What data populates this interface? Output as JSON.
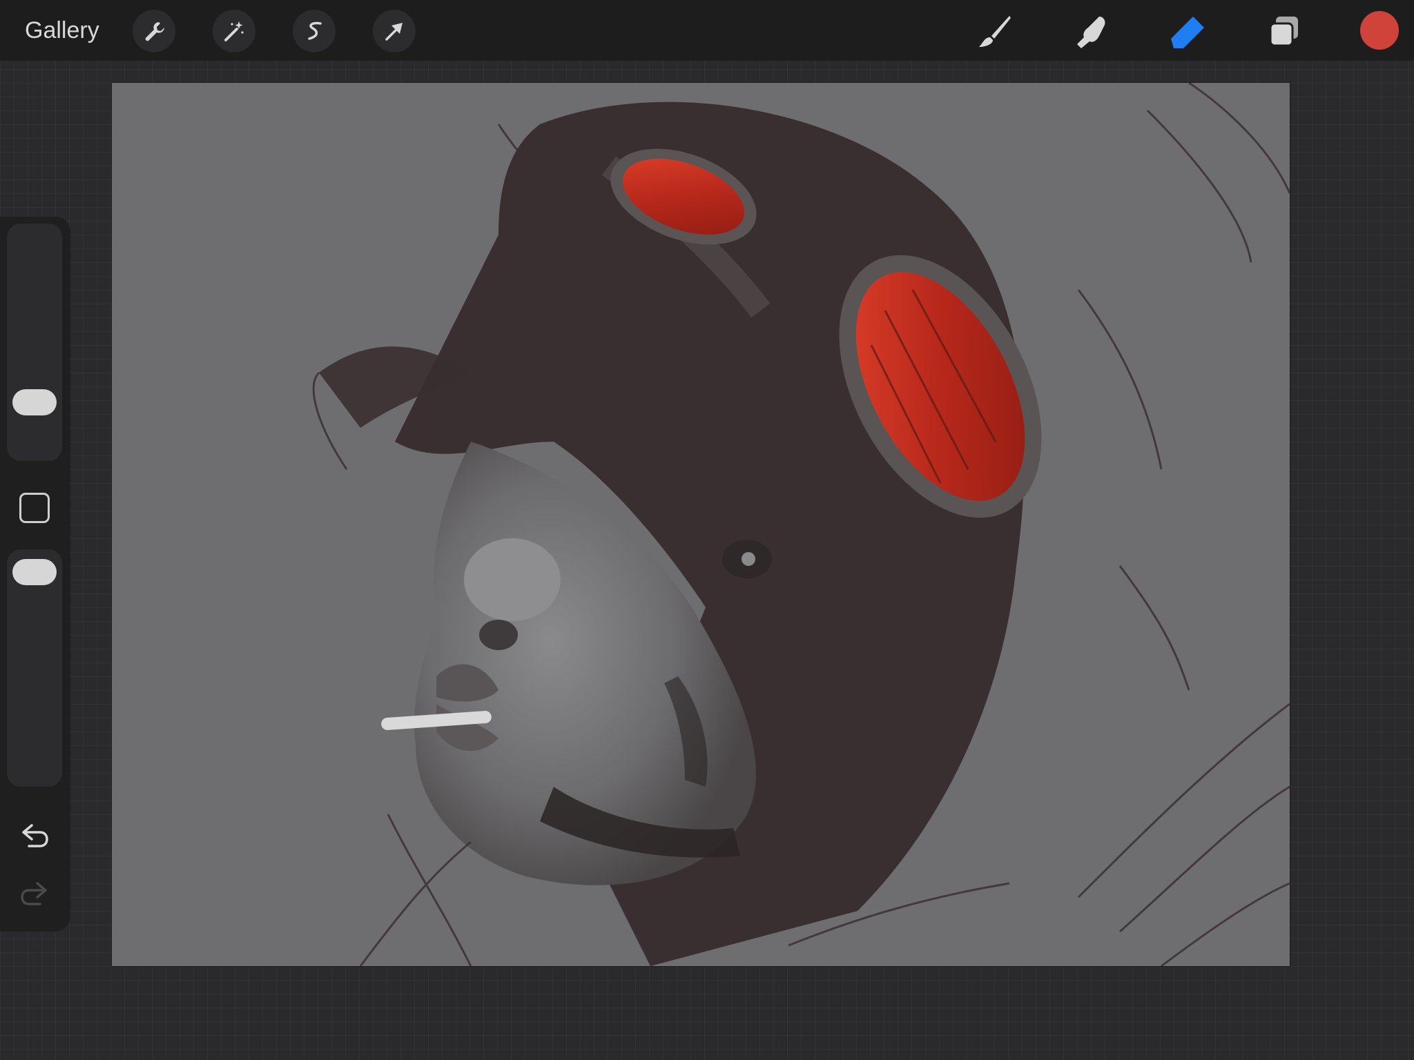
{
  "toolbar": {
    "gallery_label": "Gallery",
    "left_tools": [
      {
        "name": "actions",
        "icon": "wrench-icon"
      },
      {
        "name": "adjustments",
        "icon": "magic-wand-icon"
      },
      {
        "name": "selection",
        "icon": "selection-s-icon"
      },
      {
        "name": "transform",
        "icon": "arrow-cursor-icon"
      }
    ],
    "right_tools": [
      {
        "name": "brush",
        "icon": "brush-icon",
        "active": false
      },
      {
        "name": "smudge",
        "icon": "smudge-finger-icon",
        "active": false
      },
      {
        "name": "eraser",
        "icon": "eraser-icon",
        "active": true
      },
      {
        "name": "layers",
        "icon": "layers-icon",
        "active": false
      }
    ],
    "current_color": "#d0433a",
    "active_tool_color": "#1e7ef2"
  },
  "sidebar": {
    "brush_size_level": 0.3,
    "opacity_level": 0.95,
    "modify_button": "square-icon",
    "undo": "undo-arrow-icon",
    "redo": "redo-arrow-icon",
    "redo_enabled": false
  },
  "canvas": {
    "background_color": "#6e6e70",
    "artwork": "portrait-sketch"
  }
}
